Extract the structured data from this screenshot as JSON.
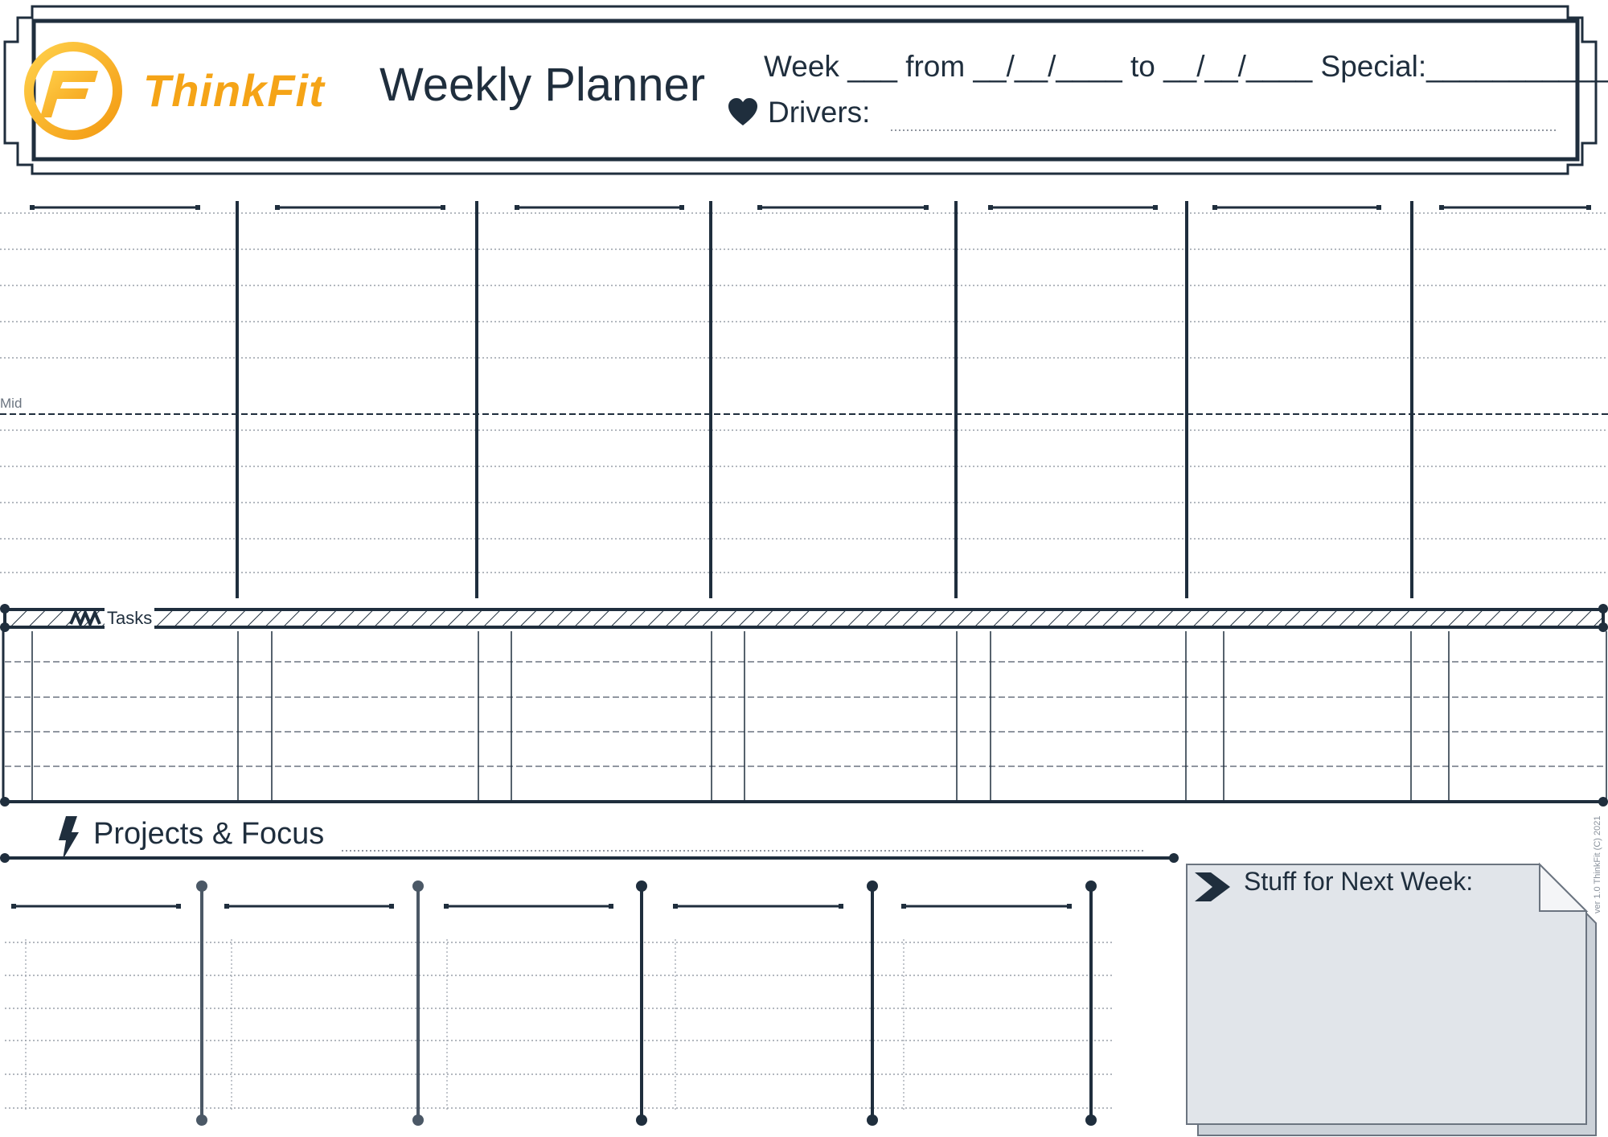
{
  "brand": {
    "name": "ThinkFit",
    "colors": {
      "orange": "#f5a417",
      "navy": "#1f2e3d"
    }
  },
  "header": {
    "title": "Weekly Planner",
    "week_line": "Week ___ from __/__/____ to __/__/____ Special:______________",
    "drivers_label": "Drivers:",
    "icons": [
      "logo-icon",
      "heart-icon"
    ]
  },
  "days_grid": {
    "mid_label": "Mid",
    "day_columns": 7
  },
  "tasks": {
    "label": "Tasks"
  },
  "projects": {
    "label": "Projects & Focus",
    "columns": 5
  },
  "next_week": {
    "label": "Stuff for Next Week:"
  },
  "footer": {
    "version": "ver 1.0 ThinkFit (C) 2021"
  }
}
